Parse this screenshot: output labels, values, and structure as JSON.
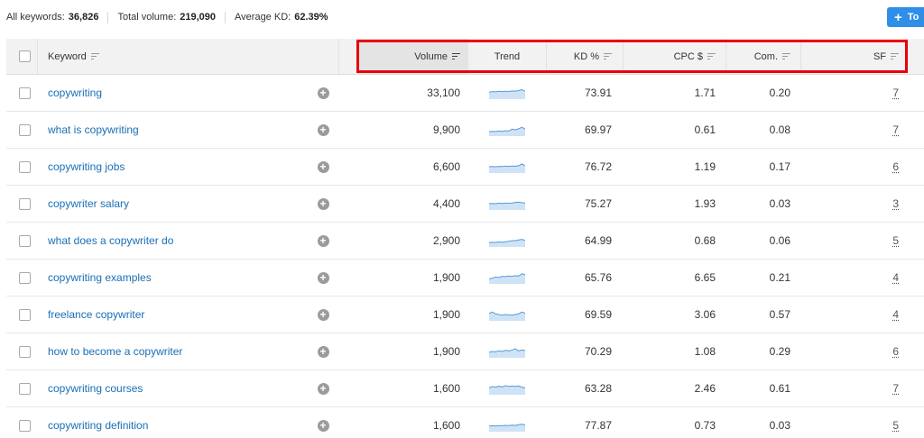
{
  "summary": {
    "all_keywords_label": "All keywords:",
    "all_keywords_value": "36,826",
    "total_volume_label": "Total volume:",
    "total_volume_value": "219,090",
    "average_kd_label": "Average KD:",
    "average_kd_value": "62.39%"
  },
  "toolbar": {
    "to_button_label": "To"
  },
  "colors": {
    "link": "#1a6fb5",
    "button": "#2e8ee8",
    "highlight": "#e8000e",
    "sparkline": "#5a9ad6"
  },
  "columns": {
    "keyword": "Keyword",
    "volume": "Volume",
    "trend": "Trend",
    "kd": "KD %",
    "cpc": "CPC $",
    "com": "Com.",
    "sf": "SF"
  },
  "rows": [
    {
      "keyword": "copywriting",
      "volume": "33,100",
      "kd": "73.91",
      "cpc": "1.71",
      "com": "0.20",
      "sf": "7",
      "trend": [
        0.55,
        0.6,
        0.58,
        0.62,
        0.6,
        0.63,
        0.6,
        0.65,
        0.62,
        0.68,
        0.75,
        0.62
      ]
    },
    {
      "keyword": "what is copywriting",
      "volume": "9,900",
      "kd": "69.97",
      "cpc": "0.61",
      "com": "0.08",
      "sf": "7",
      "trend": [
        0.35,
        0.38,
        0.36,
        0.4,
        0.38,
        0.42,
        0.4,
        0.55,
        0.5,
        0.58,
        0.7,
        0.55
      ]
    },
    {
      "keyword": "copywriting jobs",
      "volume": "6,600",
      "kd": "76.72",
      "cpc": "1.19",
      "com": "0.17",
      "sf": "6",
      "trend": [
        0.5,
        0.52,
        0.5,
        0.53,
        0.52,
        0.54,
        0.53,
        0.55,
        0.54,
        0.58,
        0.72,
        0.58
      ]
    },
    {
      "keyword": "copywriter salary",
      "volume": "4,400",
      "kd": "75.27",
      "cpc": "1.93",
      "com": "0.03",
      "sf": "3",
      "trend": [
        0.5,
        0.52,
        0.5,
        0.54,
        0.52,
        0.55,
        0.53,
        0.56,
        0.6,
        0.62,
        0.58,
        0.55
      ]
    },
    {
      "keyword": "what does a copywriter do",
      "volume": "2,900",
      "kd": "64.99",
      "cpc": "0.68",
      "com": "0.06",
      "sf": "5",
      "trend": [
        0.35,
        0.37,
        0.36,
        0.4,
        0.38,
        0.42,
        0.45,
        0.5,
        0.5,
        0.55,
        0.6,
        0.52
      ]
    },
    {
      "keyword": "copywriting examples",
      "volume": "1,900",
      "kd": "65.76",
      "cpc": "6.65",
      "com": "0.21",
      "sf": "4",
      "trend": [
        0.4,
        0.45,
        0.55,
        0.5,
        0.6,
        0.58,
        0.62,
        0.6,
        0.65,
        0.62,
        0.8,
        0.72
      ]
    },
    {
      "keyword": "freelance copywriter",
      "volume": "1,900",
      "kd": "69.59",
      "cpc": "3.06",
      "com": "0.57",
      "sf": "4",
      "trend": [
        0.6,
        0.7,
        0.55,
        0.5,
        0.45,
        0.5,
        0.48,
        0.45,
        0.5,
        0.55,
        0.7,
        0.6
      ]
    },
    {
      "keyword": "how to become a copywriter",
      "volume": "1,900",
      "kd": "70.29",
      "cpc": "1.08",
      "com": "0.29",
      "sf": "6",
      "trend": [
        0.45,
        0.5,
        0.48,
        0.55,
        0.5,
        0.6,
        0.55,
        0.62,
        0.7,
        0.55,
        0.62,
        0.58
      ]
    },
    {
      "keyword": "copywriting courses",
      "volume": "1,600",
      "kd": "63.28",
      "cpc": "2.46",
      "com": "0.61",
      "sf": "7",
      "trend": [
        0.55,
        0.65,
        0.6,
        0.68,
        0.62,
        0.72,
        0.65,
        0.7,
        0.65,
        0.7,
        0.6,
        0.55
      ]
    },
    {
      "keyword": "copywriting definition",
      "volume": "1,600",
      "kd": "77.87",
      "cpc": "0.73",
      "com": "0.03",
      "sf": "5",
      "trend": [
        0.45,
        0.47,
        0.46,
        0.48,
        0.47,
        0.5,
        0.48,
        0.52,
        0.5,
        0.55,
        0.6,
        0.52
      ]
    }
  ]
}
